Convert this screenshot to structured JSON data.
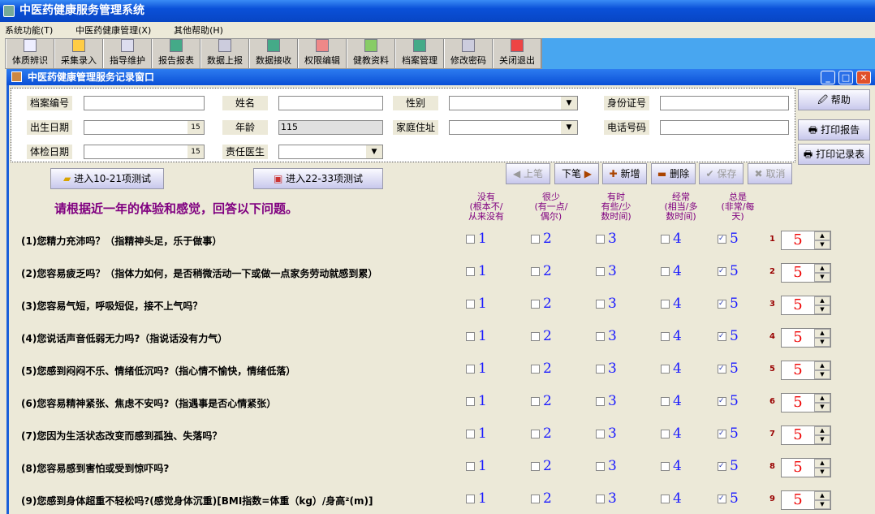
{
  "app": {
    "title": "中医药健康服务管理系统"
  },
  "menu": [
    "系统功能(T)",
    "中医药健康管理(X)",
    "其他帮助(H)"
  ],
  "toolbar": [
    "体质辨识",
    "采集录入",
    "指导维护",
    "报告报表",
    "数据上报",
    "数据接收",
    "权限编辑",
    "健教资料",
    "档案管理",
    "修改密码",
    "关闭退出"
  ],
  "window": {
    "title": "中医药健康管理服务记录窗口"
  },
  "form": {
    "archive_no": {
      "label": "档案编号",
      "value": ""
    },
    "name": {
      "label": "姓名",
      "value": ""
    },
    "gender": {
      "label": "性别",
      "value": ""
    },
    "id_no": {
      "label": "身份证号",
      "value": ""
    },
    "birth": {
      "label": "出生日期",
      "value": ""
    },
    "age": {
      "label": "年龄",
      "value": "115"
    },
    "address": {
      "label": "家庭住址",
      "value": ""
    },
    "phone": {
      "label": "电话号码",
      "value": ""
    },
    "exam_date": {
      "label": "体检日期",
      "value": ""
    },
    "doctor": {
      "label": "责任医生",
      "value": ""
    }
  },
  "side": {
    "help": "帮助",
    "print_report": "打印报告",
    "print_record": "打印记录表"
  },
  "nav": {
    "goto_10_21": "进入10-21项测试",
    "goto_22_33": "进入22-33项测试",
    "prev": "上笔",
    "next": "下笔",
    "add": "新增",
    "delete": "删除",
    "save": "保存",
    "cancel": "取消"
  },
  "prompt": "请根据近一年的体验和感觉，回答以下问题。",
  "headers": [
    "没有\n(根本不/\n从来没有",
    "很少\n(有一点/\n偶尔)",
    "有时\n有些/少\n数时间)",
    "经常\n(相当/多\n数时间)",
    "总是\n(非常/每\n天)"
  ],
  "questions": [
    {
      "text": "(1)您精力充沛吗？（指精神头足，乐于做事）",
      "num": "1",
      "checked": 5,
      "value": "5"
    },
    {
      "text": "(2)您容易疲乏吗？（指体力如何，是否稍微活动一下或做一点家务劳动就感到累）",
      "num": "2",
      "checked": 5,
      "value": "5"
    },
    {
      "text": "(3)您容易气短，呼吸短促，接不上气吗？",
      "num": "3",
      "checked": 5,
      "value": "5"
    },
    {
      "text": "(4)您说话声音低弱无力吗?（指说话没有力气）",
      "num": "4",
      "checked": 5,
      "value": "5"
    },
    {
      "text": "(5)您感到闷闷不乐、情绪低沉吗?（指心情不愉快，情绪低落）",
      "num": "5",
      "checked": 5,
      "value": "5"
    },
    {
      "text": "(6)您容易精神紧张、焦虑不安吗?（指遇事是否心情紧张）",
      "num": "6",
      "checked": 5,
      "value": "5"
    },
    {
      "text": "(7)您因为生活状态改变而感到孤独、失落吗？",
      "num": "7",
      "checked": 5,
      "value": "5"
    },
    {
      "text": "(8)您容易感到害怕或受到惊吓吗?",
      "num": "8",
      "checked": 5,
      "value": "5"
    },
    {
      "text": "(9)您感到身体超重不轻松吗?(感觉身体沉重)[BMI指数=体重（kg）/身高²(m)]",
      "num": "9",
      "checked": 5,
      "value": "5"
    }
  ],
  "options": [
    "1",
    "2",
    "3",
    "4",
    "5"
  ]
}
